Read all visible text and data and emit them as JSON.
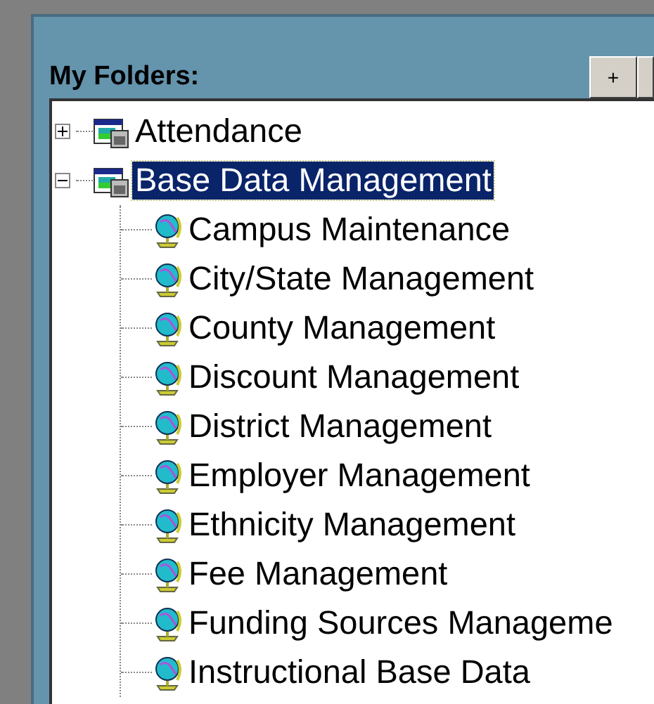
{
  "panel": {
    "title": "My Folders:",
    "buttons": [
      {
        "kind": "plus",
        "label": "+"
      },
      {
        "kind": "blank"
      }
    ]
  },
  "tree": [
    {
      "label": "Attendance",
      "kind": "folder",
      "expanded": false,
      "selected": false
    },
    {
      "label": "Base Data Management",
      "kind": "folder",
      "expanded": true,
      "selected": true,
      "children": [
        {
          "label": "Campus Maintenance",
          "kind": "module",
          "selected": false
        },
        {
          "label": "City/State Management",
          "kind": "module",
          "selected": false
        },
        {
          "label": "County Management",
          "kind": "module",
          "selected": false
        },
        {
          "label": "Discount Management",
          "kind": "module",
          "selected": false
        },
        {
          "label": "District Management",
          "kind": "module",
          "selected": false
        },
        {
          "label": "Employer Management",
          "kind": "module",
          "selected": false
        },
        {
          "label": "Ethnicity Management",
          "kind": "module",
          "selected": false
        },
        {
          "label": "Fee Management",
          "kind": "module",
          "selected": false
        },
        {
          "label": "Funding Sources Manageme",
          "kind": "module",
          "selected": false
        },
        {
          "label": "Instructional Base Data",
          "kind": "module",
          "selected": false
        }
      ]
    }
  ]
}
